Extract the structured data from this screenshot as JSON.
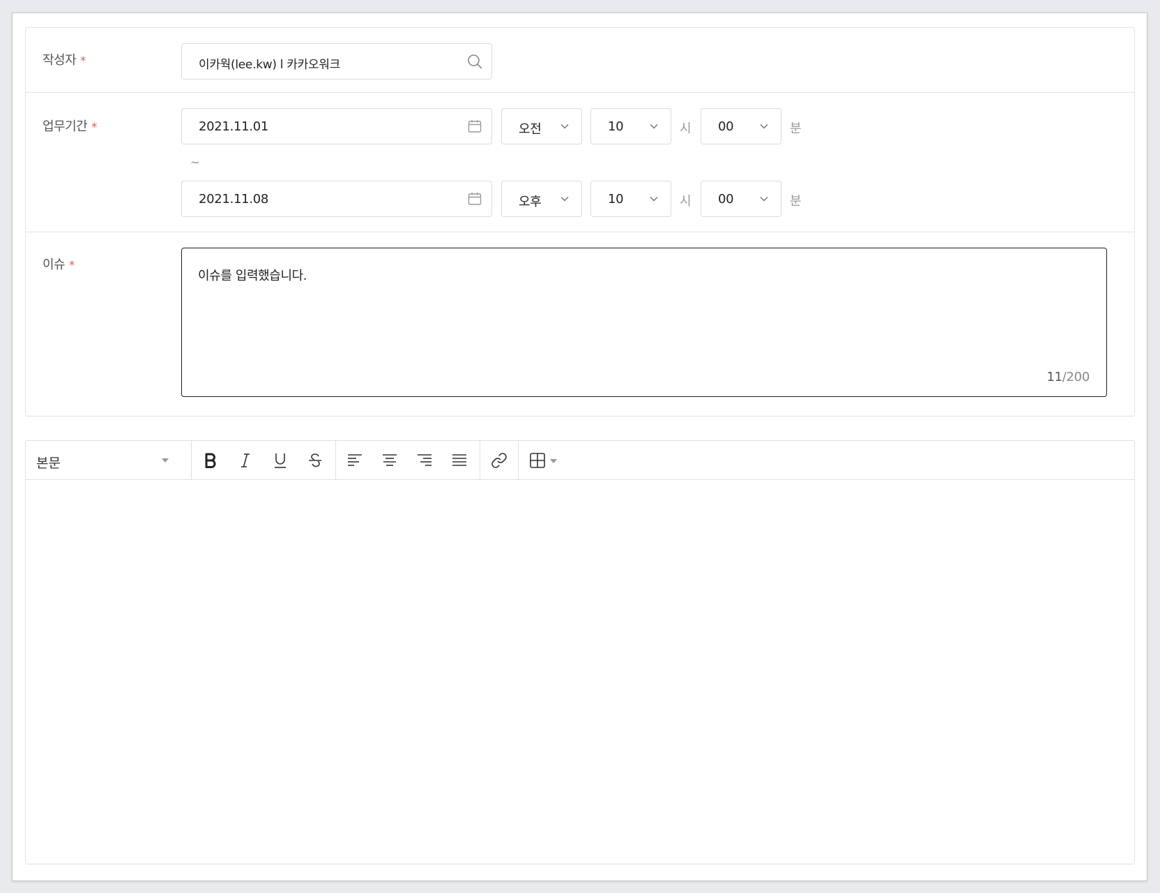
{
  "author": {
    "label": "작성자",
    "required_mark": "*",
    "value": "이카웍(lee.kw) l 카카오워크",
    "icon": "search-icon"
  },
  "period": {
    "label": "업무기간",
    "required_mark": "*",
    "separator": "~",
    "start": {
      "date": "2021.11.01",
      "ampm": "오전",
      "hour": "10",
      "hour_unit": "시",
      "minute": "00",
      "minute_unit": "분"
    },
    "end": {
      "date": "2021.11.08",
      "ampm": "오후",
      "hour": "10",
      "hour_unit": "시",
      "minute": "00",
      "minute_unit": "분"
    }
  },
  "issue": {
    "label": "이슈",
    "required_mark": "*",
    "value": "이슈를 입력했습니다.",
    "count": "11",
    "count_sep": "/",
    "max": "200"
  },
  "editor": {
    "paragraph_style": "본문",
    "tools": [
      "bold-icon",
      "italic-icon",
      "underline-icon",
      "strikethrough-icon",
      "align-left-icon",
      "align-center-icon",
      "align-right-icon",
      "align-justify-icon",
      "link-icon",
      "table-icon"
    ]
  }
}
